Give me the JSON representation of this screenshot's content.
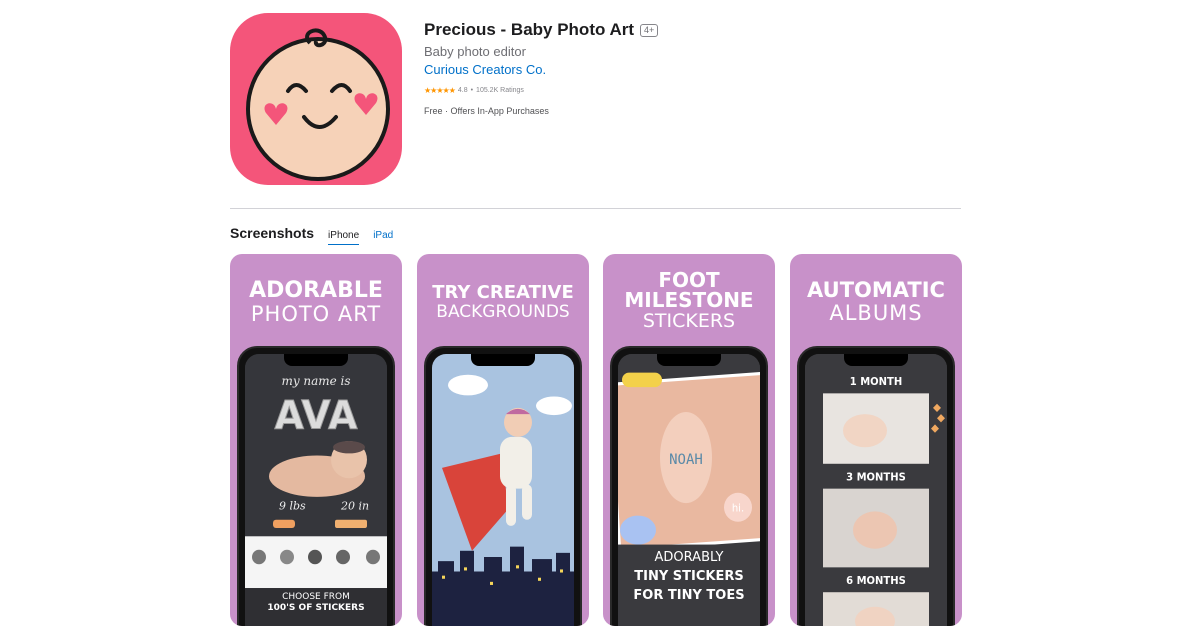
{
  "app": {
    "title": "Precious - Baby Photo Art",
    "age_rating": "4+",
    "subtitle": "Baby photo editor",
    "developer": "Curious Creators Co.",
    "stars": "★★★★★",
    "rating": "4.8",
    "rating_sep": "•",
    "ratings_count": "105.2K Ratings",
    "price": "Free · Offers In-App Purchases",
    "icon_color": "#f4557a"
  },
  "screenshots": {
    "heading": "Screenshots",
    "tabs": [
      {
        "label": "iPhone",
        "active": true
      },
      {
        "label": "iPad",
        "active": false
      }
    ],
    "background_color": "#c891c9",
    "items": [
      {
        "caption_line1": "ADORABLE",
        "caption_line2": "PHOTO ART",
        "screen_text_top": "my name is",
        "screen_name": "AVA",
        "weight": "9 lbs",
        "length": "20 in",
        "footer_line1": "CHOOSE FROM",
        "footer_line2": "100'S OF STICKERS"
      },
      {
        "caption_line1": "TRY CREATIVE",
        "caption_line2": "BACKGROUNDS"
      },
      {
        "caption_line1": "FOOT",
        "caption_line2": "MILESTONE",
        "caption_line3": "STICKERS",
        "sticker_name": "NOAH",
        "balloon_text": "hi.",
        "footer_line1": "ADORABLY",
        "footer_line2": "TINY STICKERS",
        "footer_line3": "FOR TINY TOES"
      },
      {
        "caption_line1": "AUTOMATIC",
        "caption_line2": "ALBUMS",
        "album_1": "1 MONTH",
        "album_2": "3 MONTHS",
        "album_3": "6 MONTHS"
      }
    ]
  }
}
